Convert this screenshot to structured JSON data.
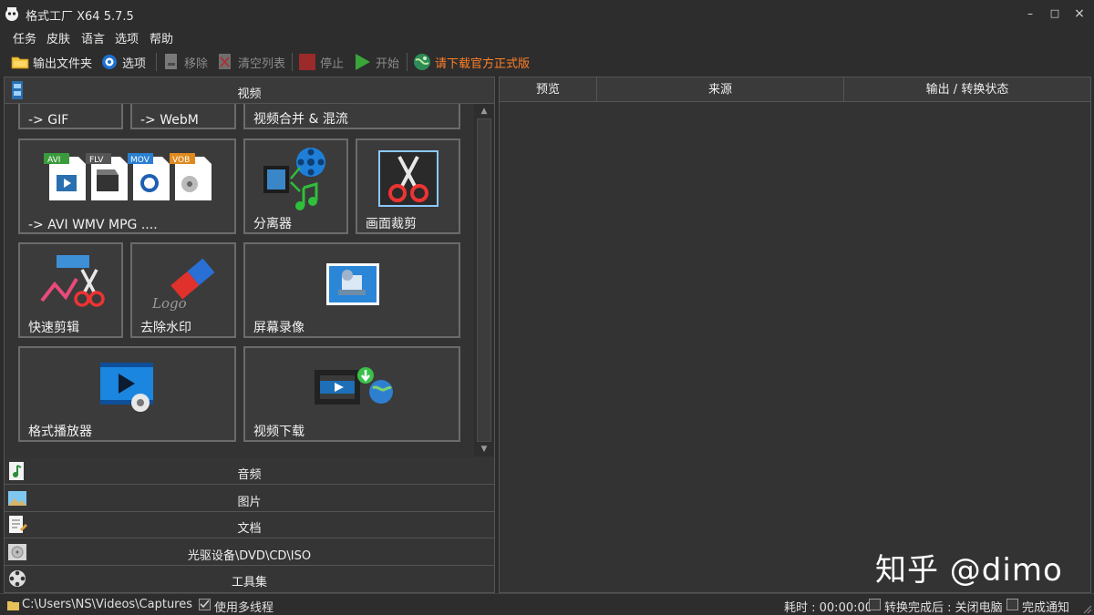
{
  "window": {
    "title": "格式工厂 X64 5.7.5",
    "minimize": "–",
    "maximize": "□",
    "close": "×"
  },
  "menu": [
    "任务",
    "皮肤",
    "语言",
    "选项",
    "帮助"
  ],
  "toolbar": {
    "output_folder": "输出文件夹",
    "options": "选项",
    "remove": "移除",
    "clear_list": "清空列表",
    "stop": "停止",
    "start": "开始",
    "download": "请下载官方正式版"
  },
  "categories": {
    "video": "视频",
    "audio": "音频",
    "picture": "图片",
    "document": "文档",
    "disc": "光驱设备\\DVD\\CD\\ISO",
    "tools": "工具集"
  },
  "tiles": {
    "gif": "-> GIF",
    "webm": "-> WebM",
    "merge": "视频合并 & 混流",
    "avi": "-> AVI WMV MPG ....",
    "splitter": "分离器",
    "crop": "画面裁剪",
    "quick_clip": "快速剪辑",
    "remove_watermark": "去除水印",
    "screen_record": "屏幕录像",
    "player": "格式播放器",
    "video_download": "视频下载"
  },
  "file_badges": [
    "AVI",
    "FLV",
    "MOV",
    "VOB"
  ],
  "watermark_logo_text": "Logo",
  "task_columns": [
    "预览",
    "来源",
    "输出 / 转换状态"
  ],
  "status": {
    "path": "C:\\Users\\NS\\Videos\\Captures",
    "multithread": "使用多线程",
    "elapsed": "耗时 : 00:00:00",
    "after_convert": "转换完成后 : 关闭电脑",
    "notify": "完成通知"
  },
  "overlay_watermark": "知乎 @dimo",
  "colors": {
    "accent_orange": "#ff7f27",
    "background": "#2b2b2b",
    "panel": "#333333",
    "tile_border": "#6b6b6b"
  }
}
